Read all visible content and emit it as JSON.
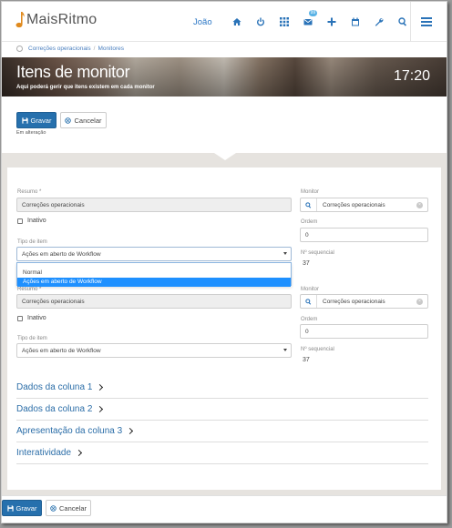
{
  "app": {
    "name": "MaisRitmo"
  },
  "header": {
    "user": "João",
    "nav_icons": [
      "home-icon",
      "power-icon",
      "apps-grid-icon",
      "mail-icon",
      "plus-icon",
      "calendar-icon",
      "wrench-icon",
      "search-icon"
    ],
    "mail_badge": "99",
    "menu_icon": "hamburger-menu-icon"
  },
  "breadcrumb": {
    "items": [
      "Correções operacionais",
      "Monitores"
    ]
  },
  "banner": {
    "title": "Itens de monitor",
    "subtitle": "Aqui poderá gerir que itens existem em cada monitor",
    "time": "17:20"
  },
  "actions": {
    "save": "Gravar",
    "cancel": "Cancelar",
    "status": "Em alteração"
  },
  "form1": {
    "resumo_label": "Resumo *",
    "resumo_value": "Correções operacionais",
    "inativo_label": "Inativo",
    "tipo_label": "Tipo de item",
    "tipo_value": "Ações em aberto de Workflow",
    "monitor_label": "Monitor",
    "monitor_value": "Correções operacionais",
    "ordem_label": "Ordem",
    "ordem_value": "0",
    "seq_label": "Nº sequencial",
    "seq_value": "37"
  },
  "dropdown": {
    "options": [
      "Normal",
      "Ações em aberto de Workflow"
    ],
    "selected_index": 1
  },
  "form2": {
    "resumo_label": "Resumo *",
    "resumo_value": "Correções operacionais",
    "inativo_label": "Inativo",
    "tipo_label": "Tipo de item",
    "tipo_value": "Ações em aberto de Workflow",
    "monitor_label": "Monitor",
    "monitor_value": "Correções operacionais",
    "ordem_label": "Ordem",
    "ordem_value": "0",
    "seq_label": "Nº sequencial",
    "seq_value": "37"
  },
  "sections": [
    "Dados da coluna 1",
    "Dados da coluna 2",
    "Apresentação da coluna 3",
    "Interatividade"
  ],
  "colors": {
    "accent": "#2670ad",
    "link": "#2c6ea8",
    "nav_icon": "#2a73b8",
    "badge": "#5ab3e6",
    "dropdown_selected": "#1e90ff",
    "logo": "#e08a1e"
  }
}
